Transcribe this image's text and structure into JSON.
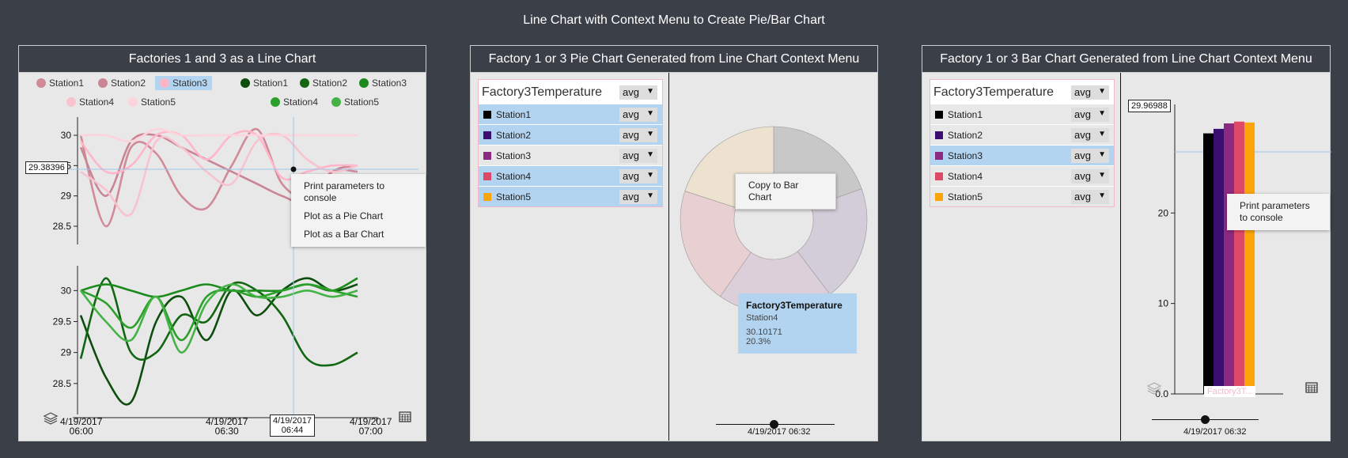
{
  "page_title": "Line Chart with Context Menu to Create Pie/Bar Chart",
  "colors": {
    "bg": "#3b3f47",
    "panel": "#e8e8e8",
    "highlight": "#b3d4f0"
  },
  "panel1": {
    "title": "Factories 1 and 3 as a Line Chart",
    "legend_pink": [
      "Station1",
      "Station2",
      "Station3",
      "Station4",
      "Station5"
    ],
    "legend_green": [
      "Station1",
      "Station2",
      "Station3",
      "Station4",
      "Station5"
    ],
    "tracker_value": "29.38396",
    "tracker_time_line1": "4/19/2017",
    "tracker_time_line2": "06:44",
    "context_menu": [
      "Print parameters to console",
      "Plot as a Pie Chart",
      "Plot as a Bar Chart"
    ],
    "x_ticks": [
      {
        "l1": "4/19/2017",
        "l2": "06:00"
      },
      {
        "l1": "4/19/2017",
        "l2": "06:30"
      },
      {
        "l1": "4/19/2017",
        "l2": "07:00"
      }
    ]
  },
  "panel2": {
    "title": "Factory 1 or 3 Pie Chart Generated from Line Chart Context Menu",
    "control_title": "Factory3Temperature",
    "agg": "avg",
    "context_menu": [
      "Copy to Bar Chart"
    ],
    "tooltip_title": "Factory3Temperature",
    "tooltip_station": "Station4",
    "tooltip_value": "30.10171",
    "tooltip_pct": "20.3%",
    "slider_label": "4/19/2017 06:32"
  },
  "panel3": {
    "title": "Factory 1 or 3 Bar Chart Generated from Line Chart Context Menu",
    "control_title": "Factory3Temperature",
    "agg": "avg",
    "tracker_value": "29.96988",
    "context_menu": [
      "Print parameters to console"
    ],
    "x_label": "Factory3T...",
    "slider_label": "4/19/2017 06:32"
  },
  "stations": [
    {
      "name": "Station1",
      "agg": "avg",
      "color": "#000000"
    },
    {
      "name": "Station2",
      "agg": "avg",
      "color": "#3b0f70"
    },
    {
      "name": "Station3",
      "agg": "avg",
      "color": "#8c2981"
    },
    {
      "name": "Station4",
      "agg": "avg",
      "color": "#de4968"
    },
    {
      "name": "Station5",
      "agg": "avg",
      "color": "#fca50a"
    }
  ],
  "chart_data": [
    {
      "type": "line",
      "title": "Factories 1 and 3 as a Line Chart",
      "subplot": "top",
      "x": [
        "06:00",
        "06:05",
        "06:10",
        "06:15",
        "06:20",
        "06:25",
        "06:30",
        "06:35",
        "06:40",
        "06:45",
        "06:50",
        "06:55"
      ],
      "ylim": [
        28.2,
        30.3
      ],
      "yticks": [
        28.5,
        29,
        29.5,
        30
      ],
      "series": [
        {
          "name": "Station1",
          "color": "#d08a98",
          "values": [
            30.0,
            28.5,
            29.8,
            29.7,
            29.0,
            28.8,
            29.5,
            30.1,
            29.2,
            29.0,
            29.4,
            29.4
          ]
        },
        {
          "name": "Station2",
          "color": "#c98593",
          "values": [
            29.8,
            29.0,
            29.9,
            30.0,
            29.8,
            29.6,
            29.4,
            29.2,
            29.0,
            28.9,
            29.4,
            29.5
          ]
        },
        {
          "name": "Station3",
          "color": "#ffb6c8",
          "values": [
            29.9,
            29.4,
            29.5,
            30.0,
            30.0,
            29.6,
            30.0,
            30.0,
            29.3,
            29.4,
            29.5,
            29.5
          ]
        },
        {
          "name": "Station4",
          "color": "#f7c3cf",
          "values": [
            29.4,
            29.1,
            28.7,
            29.9,
            29.8,
            29.4,
            29.2,
            29.9,
            30.0,
            29.6,
            29.4,
            29.5
          ]
        },
        {
          "name": "Station5",
          "color": "#fdd3dc",
          "values": [
            30.0,
            30.0,
            29.9,
            30.1,
            30.0,
            30.0,
            30.0,
            30.0,
            30.0,
            30.0,
            30.0,
            30.0
          ]
        }
      ]
    },
    {
      "type": "line",
      "subplot": "bottom",
      "x": [
        "06:00",
        "06:05",
        "06:10",
        "06:15",
        "06:20",
        "06:25",
        "06:30",
        "06:35",
        "06:40",
        "06:45",
        "06:50",
        "06:55"
      ],
      "ylim": [
        28.0,
        30.4
      ],
      "yticks": [
        28.5,
        29,
        29.5,
        30
      ],
      "series": [
        {
          "name": "Station1",
          "color": "#0d4d0d",
          "values": [
            29.6,
            28.6,
            28.2,
            29.5,
            29.9,
            29.2,
            30.0,
            29.6,
            30.0,
            30.2,
            30.0,
            30.1
          ]
        },
        {
          "name": "Station2",
          "color": "#126612",
          "values": [
            28.9,
            30.2,
            29.0,
            29.0,
            29.6,
            29.5,
            30.1,
            30.0,
            29.6,
            28.9,
            28.8,
            29.0
          ]
        },
        {
          "name": "Station3",
          "color": "#1a8a1a",
          "values": [
            30.0,
            30.1,
            30.0,
            29.9,
            30.0,
            30.1,
            30.0,
            30.0,
            30.0,
            30.1,
            30.0,
            30.2
          ]
        },
        {
          "name": "Station4",
          "color": "#2aa02a",
          "values": [
            30.0,
            29.8,
            29.4,
            29.9,
            29.2,
            29.9,
            30.0,
            29.9,
            30.0,
            30.1,
            30.0,
            29.9
          ]
        },
        {
          "name": "Station5",
          "color": "#44b244",
          "values": [
            30.0,
            29.5,
            29.2,
            29.9,
            29.0,
            29.8,
            30.1,
            29.9,
            29.9,
            30.0,
            29.9,
            30.0
          ]
        }
      ]
    },
    {
      "type": "pie",
      "title": "Factory 1 or 3 Pie Chart Generated from Line Chart Context Menu",
      "categories": [
        "Station1",
        "Station2",
        "Station3",
        "Station4",
        "Station5"
      ],
      "values": [
        19.6,
        20.1,
        20.0,
        20.3,
        20.0
      ],
      "colors": [
        "#c8c8c8",
        "#d3ccd9",
        "#dccfd9",
        "#e8d0d2",
        "#ece2cf"
      ]
    },
    {
      "type": "bar",
      "title": "Factory 1 or 3 Bar Chart Generated from Line Chart Context Menu",
      "categories": [
        "Station1",
        "Station2",
        "Station3",
        "Station4",
        "Station5"
      ],
      "values": [
        28.8,
        29.3,
        29.9,
        30.1,
        30.0
      ],
      "ylim": [
        0,
        32
      ],
      "yticks": [
        0,
        10,
        20
      ],
      "ytick_labels": [
        "0.0",
        "10",
        "20"
      ]
    }
  ]
}
